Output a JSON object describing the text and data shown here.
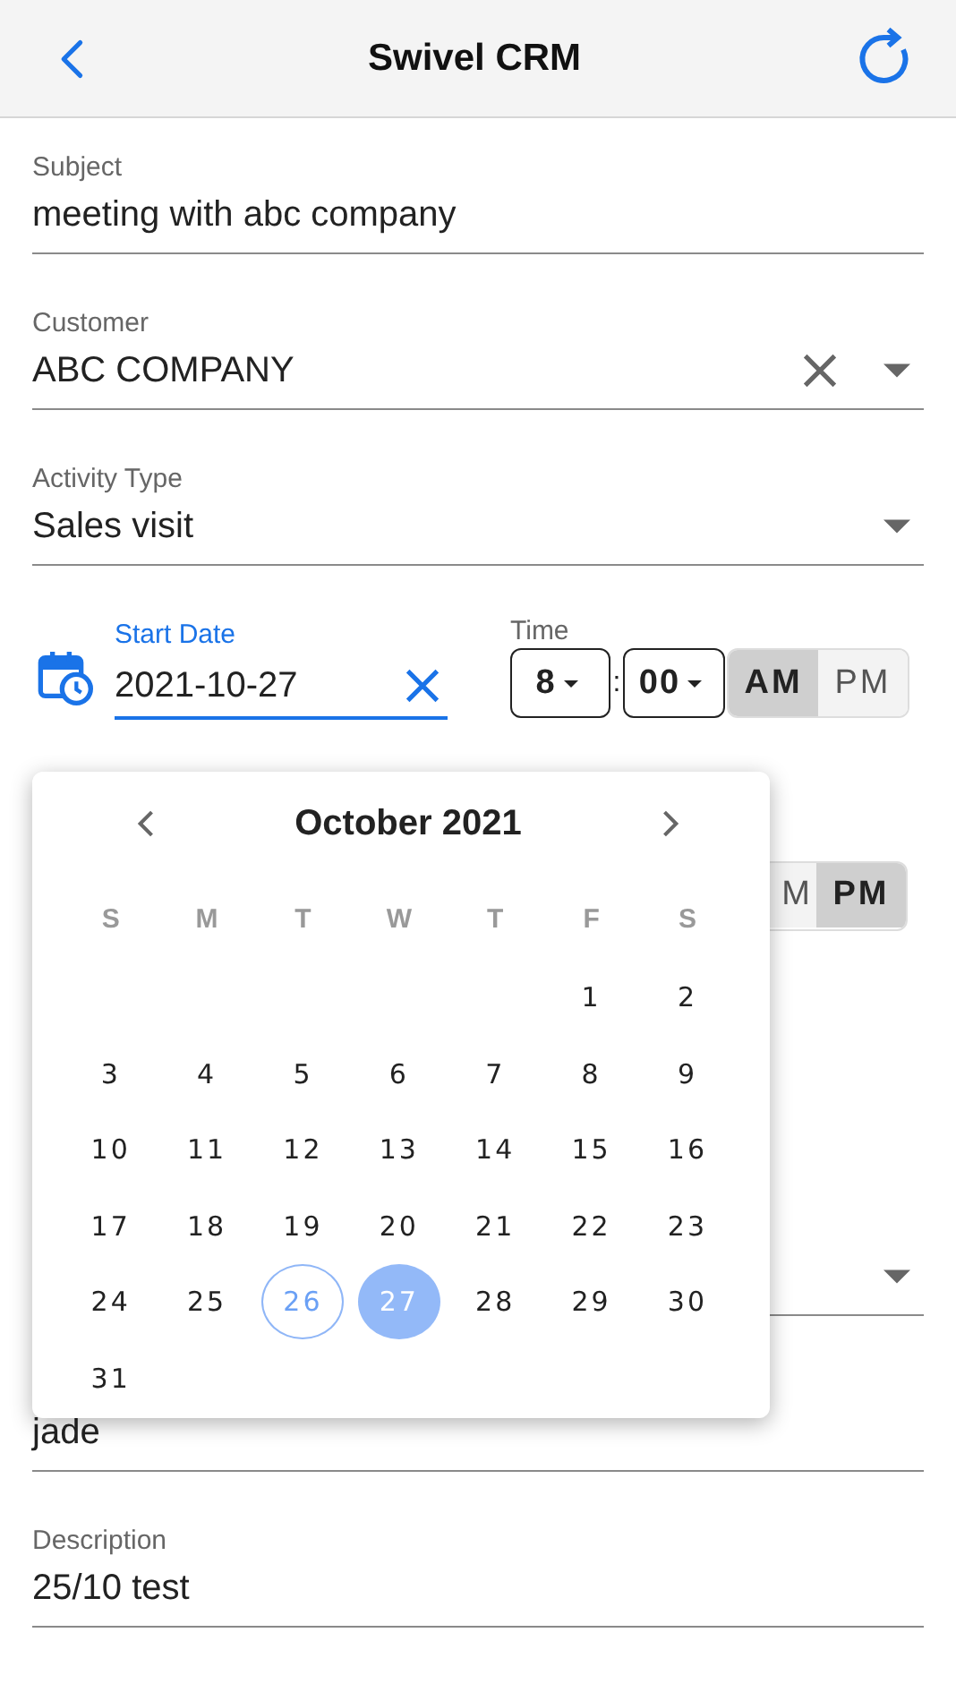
{
  "header": {
    "title": "Swivel CRM"
  },
  "fields": [
    {
      "kind": "text",
      "label": "Subject",
      "value": "meeting with abc company"
    },
    {
      "kind": "select",
      "label": "Customer",
      "value": "ABC COMPANY",
      "clearable": true
    },
    {
      "kind": "select",
      "label": "Activity Type",
      "value": "Sales visit",
      "clearable": false
    }
  ],
  "start": {
    "label": "Start Date",
    "value": "2021-10-27",
    "focused": true,
    "time_label": "Time",
    "hour": "8",
    "minute": "00",
    "separator": ":",
    "am": "AM",
    "pm": "PM",
    "pm_selected": false
  },
  "end_time": {
    "am": "M",
    "pm": "PM",
    "pm_selected": true
  },
  "lower_fields": [
    {
      "kind": "select"
    },
    {
      "kind": "text",
      "value": "jade"
    },
    {
      "kind": "text",
      "label": "Description",
      "value": "25/10 test"
    }
  ],
  "calendar": {
    "title": "October 2021",
    "weekdays": [
      "S",
      "M",
      "T",
      "W",
      "T",
      "F",
      "S"
    ],
    "weeks": [
      {
        "days": [
          {
            "label": "1",
            "selected": false,
            "today": false
          },
          {
            "label": "2",
            "selected": false,
            "today": false
          }
        ]
      },
      {
        "days": [
          {
            "label": "3",
            "selected": false,
            "today": false
          },
          {
            "label": "4",
            "selected": false,
            "today": false
          },
          {
            "label": "5",
            "selected": false,
            "today": false
          },
          {
            "label": "6",
            "selected": false,
            "today": false
          },
          {
            "label": "7",
            "selected": false,
            "today": false
          },
          {
            "label": "8",
            "selected": false,
            "today": false
          },
          {
            "label": "9",
            "selected": false,
            "today": false
          }
        ]
      },
      {
        "days": [
          {
            "label": "10",
            "selected": false,
            "today": false
          },
          {
            "label": "11",
            "selected": false,
            "today": false
          },
          {
            "label": "12",
            "selected": false,
            "today": false
          },
          {
            "label": "13",
            "selected": false,
            "today": false
          },
          {
            "label": "14",
            "selected": false,
            "today": false
          },
          {
            "label": "15",
            "selected": false,
            "today": false
          },
          {
            "label": "16",
            "selected": false,
            "today": false
          }
        ]
      },
      {
        "days": [
          {
            "label": "17",
            "selected": false,
            "today": false
          },
          {
            "label": "18",
            "selected": false,
            "today": false
          },
          {
            "label": "19",
            "selected": false,
            "today": false
          },
          {
            "label": "20",
            "selected": false,
            "today": false
          },
          {
            "label": "21",
            "selected": false,
            "today": false
          },
          {
            "label": "22",
            "selected": false,
            "today": false
          },
          {
            "label": "23",
            "selected": false,
            "today": false
          }
        ]
      },
      {
        "days": [
          {
            "label": "24",
            "selected": false,
            "today": false
          },
          {
            "label": "25",
            "selected": false,
            "today": false
          },
          {
            "label": "26",
            "selected": false,
            "today": true
          },
          {
            "label": "27",
            "selected": true,
            "today": false
          },
          {
            "label": "28",
            "selected": false,
            "today": false
          },
          {
            "label": "29",
            "selected": false,
            "today": false
          },
          {
            "label": "30",
            "selected": false,
            "today": false
          }
        ]
      },
      {
        "days": [
          {
            "label": "31",
            "selected": false,
            "today": false
          }
        ]
      }
    ]
  }
}
